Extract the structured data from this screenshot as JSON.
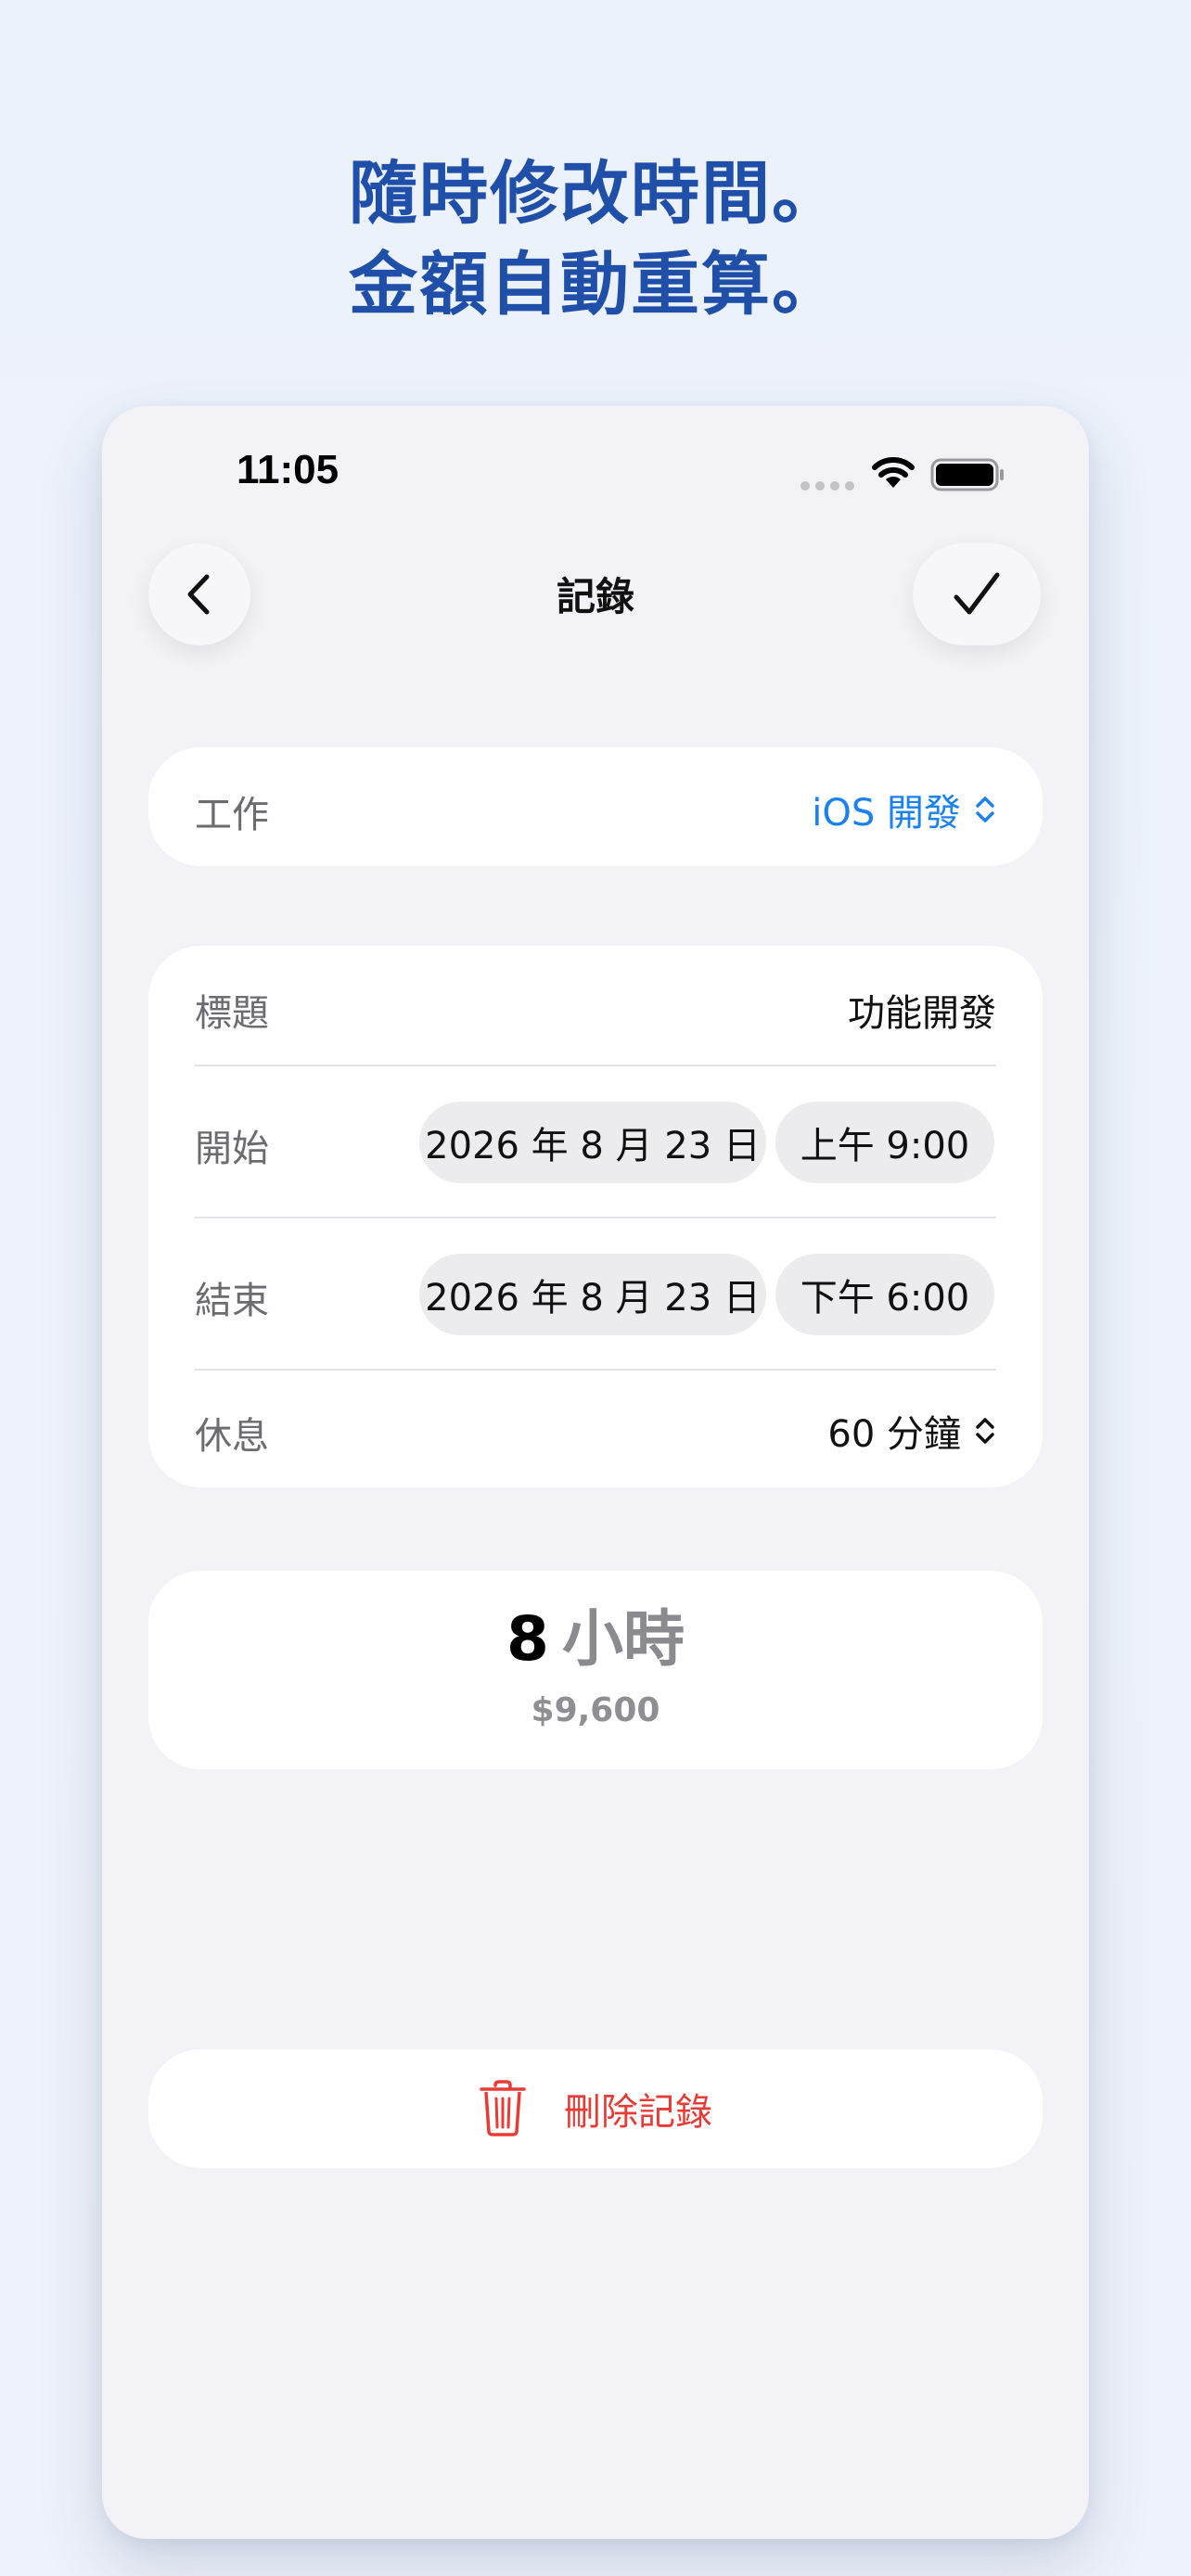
{
  "headline": {
    "line1": "隨時修改時間。",
    "line2": "金額自動重算。"
  },
  "status_bar": {
    "time": "11:05"
  },
  "nav": {
    "title": "記錄",
    "back_icon": "chevron-left-icon",
    "done_icon": "checkmark-icon"
  },
  "job": {
    "label": "工作",
    "value": "iOS 開發"
  },
  "details": {
    "title_label": "標題",
    "title_value": "功能開發",
    "start_label": "開始",
    "start_date": "2026 年 8 月 23 日",
    "start_time": "上午 9:00",
    "end_label": "結束",
    "end_date": "2026 年 8 月 23 日",
    "end_time": "下午 6:00",
    "break_label": "休息",
    "break_value": "60 分鐘"
  },
  "total": {
    "hours": "8",
    "unit": "小時",
    "amount": "$9,600"
  },
  "delete": {
    "label": "刪除記錄",
    "icon": "trash-icon"
  },
  "colors": {
    "headline": "#1f4fa8",
    "accent_blue": "#1a82f0",
    "destructive_red": "#e83b36",
    "background": "#f2f2f7"
  }
}
